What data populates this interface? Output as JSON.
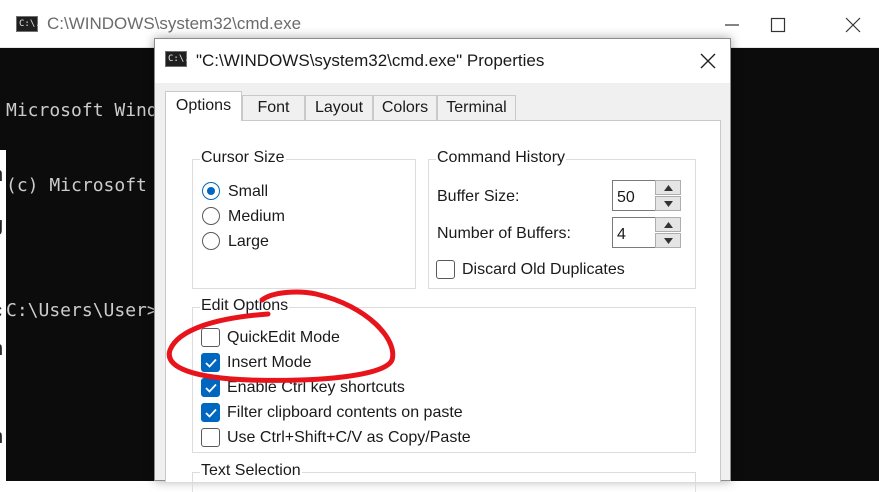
{
  "console": {
    "title": "C:\\WINDOWS\\system32\\cmd.exe",
    "icon_text": "C:\\.",
    "lines": [
      "Microsoft Wind",
      "(c) Microsoft ",
      "",
      "C:\\Users\\User>"
    ]
  },
  "dialog": {
    "title": "\"C:\\WINDOWS\\system32\\cmd.exe\" Properties",
    "icon_text": "C:\\.",
    "tabs": [
      {
        "label": "Options",
        "active": true
      },
      {
        "label": "Font"
      },
      {
        "label": "Layout"
      },
      {
        "label": "Colors"
      },
      {
        "label": "Terminal"
      }
    ],
    "cursor_size": {
      "label": "Cursor Size",
      "options": [
        {
          "label": "Small",
          "selected": true
        },
        {
          "label": "Medium"
        },
        {
          "label": "Large"
        }
      ]
    },
    "command_history": {
      "label": "Command History",
      "buffer_size_label": "Buffer Size:",
      "buffer_size_value": "50",
      "number_of_buffers_label": "Number of Buffers:",
      "number_of_buffers_value": "4",
      "discard_label": "Discard Old Duplicates",
      "discard_checked": false
    },
    "edit_options": {
      "label": "Edit Options",
      "items": [
        {
          "label": "QuickEdit Mode",
          "checked": false
        },
        {
          "label": "Insert Mode",
          "checked": true
        },
        {
          "label": "Enable Ctrl key shortcuts",
          "checked": true
        },
        {
          "label": "Filter clipboard contents on paste",
          "checked": true
        },
        {
          "label": "Use Ctrl+Shift+C/V as Copy/Paste",
          "checked": false
        }
      ]
    },
    "text_selection": {
      "label": "Text Selection"
    }
  },
  "colors": {
    "accent": "#0067c0",
    "annotation": "#e8141b",
    "console_bg": "#0c0c0c"
  }
}
